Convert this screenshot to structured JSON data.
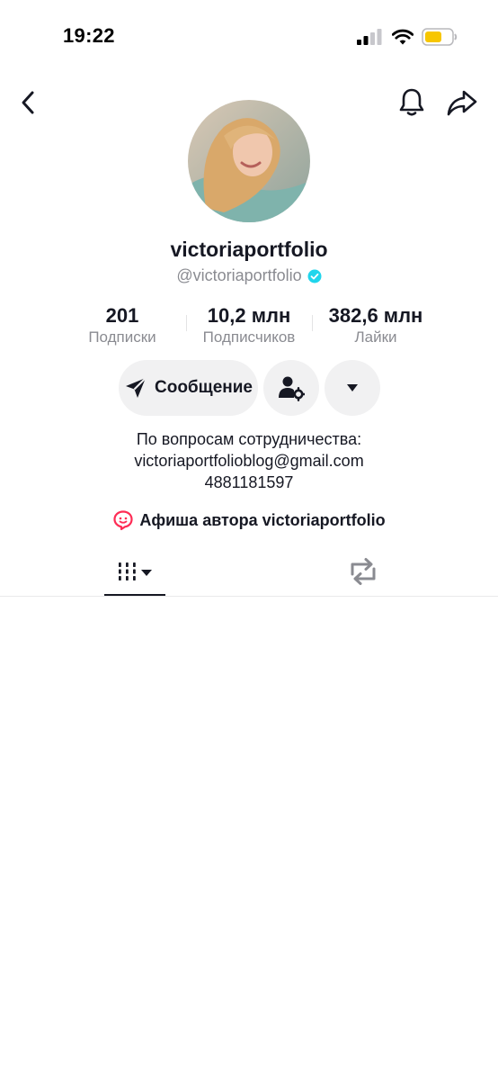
{
  "status_bar": {
    "time": "19:22",
    "icons": [
      "cellular-signal-icon",
      "wifi-icon",
      "battery-icon"
    ],
    "battery_color": "#f7c600"
  },
  "nav": {
    "icons": [
      "back-chevron-icon",
      "bell-icon",
      "share-arrow-icon"
    ]
  },
  "profile": {
    "display_name": "victoriaportfolio",
    "handle": "@victoriaportfolio",
    "verified_color": "#20d5ec"
  },
  "stats": [
    {
      "value": "201",
      "label": "Подписки"
    },
    {
      "value": "10,2 млн",
      "label": "Подписчиков"
    },
    {
      "value": "382,6 млн",
      "label": "Лайки"
    }
  ],
  "actions": {
    "message_label": "Сообщение",
    "icons": [
      "send-icon",
      "add-friend-settings-icon",
      "caret-down-icon"
    ]
  },
  "bio": {
    "lines": [
      "По вопросам сотрудничества:",
      "victoriaportfolioblog@gmail.com",
      "4881181597"
    ]
  },
  "events": {
    "label": "Афиша автора victoriaportfolio",
    "accent_color": "#fe2c55"
  },
  "tabs": {
    "icons": [
      "videos-grid-icon",
      "reposts-icon"
    ]
  }
}
